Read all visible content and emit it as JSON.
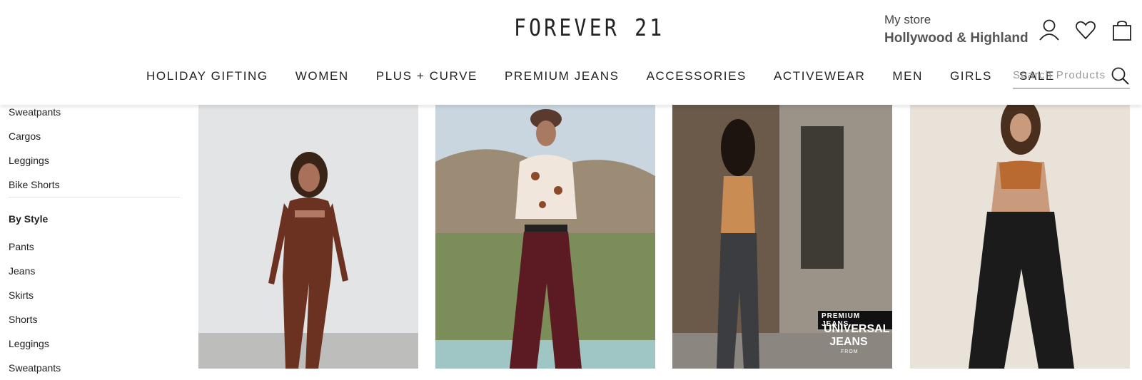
{
  "header": {
    "logo": "FOREVER 21",
    "store_label": "My store",
    "store_name": "Hollywood & Highland",
    "nav": [
      "HOLIDAY GIFTING",
      "WOMEN",
      "PLUS + CURVE",
      "PREMIUM JEANS",
      "ACCESSORIES",
      "ACTIVEWEAR",
      "MEN",
      "GIRLS",
      "SALE"
    ],
    "search_placeholder": "Search Products",
    "icons": [
      "account-icon",
      "heart-icon",
      "shopping-bag-icon",
      "search-icon"
    ]
  },
  "sidebar": {
    "top_items": [
      "Sweatpants",
      "Cargos",
      "Leggings",
      "Bike Shorts"
    ],
    "style_heading": "By Style",
    "style_items": [
      "Pants",
      "Jeans",
      "Skirts",
      "Shorts",
      "Leggings",
      "Sweatpants"
    ]
  },
  "products": [
    {
      "image": "brown-seamless-set"
    },
    {
      "image": "floral-top-burgundy-flares"
    },
    {
      "image": "grey-jeans-lace-up-top",
      "badge": "PREMIUM JEANS",
      "overlay_title": "UNIVERSAL JEANS",
      "overlay_sub": "FROM"
    },
    {
      "image": "leather-pants-halter-top"
    }
  ],
  "colors": {
    "text": "#222222",
    "muted": "#999999",
    "divider": "#e2e2e2"
  }
}
